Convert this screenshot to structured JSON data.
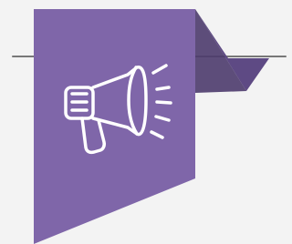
{
  "graphic": {
    "icon_name": "megaphone-icon",
    "colors": {
      "background": "#f3f3f3",
      "ribbon": "#7f66a9",
      "ribbon_fold": "#5e4a84",
      "ribbon_fold_dark": "#4c3b6d",
      "line": "#777777",
      "icon_stroke": "#ffffff"
    }
  }
}
